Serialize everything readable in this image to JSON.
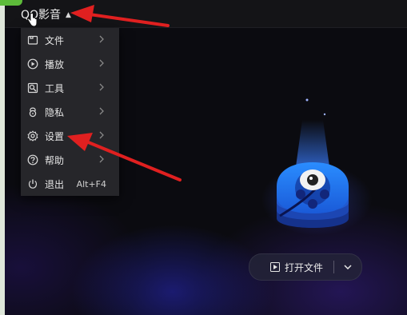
{
  "app": {
    "title": "QQ影音"
  },
  "menu": {
    "items": [
      {
        "label": "文件",
        "icon": "folder-icon",
        "has_submenu": true
      },
      {
        "label": "播放",
        "icon": "play-circle-icon",
        "has_submenu": true
      },
      {
        "label": "工具",
        "icon": "tools-icon",
        "has_submenu": true
      },
      {
        "label": "隐私",
        "icon": "lock-icon",
        "has_submenu": true
      },
      {
        "label": "设置",
        "icon": "gear-icon",
        "has_submenu": true
      },
      {
        "label": "帮助",
        "icon": "help-icon",
        "has_submenu": true
      },
      {
        "label": "退出",
        "icon": "power-icon",
        "shortcut": "Alt+F4"
      }
    ]
  },
  "main": {
    "open_file_label": "打开文件"
  },
  "colors": {
    "annotation_arrow": "#e02020",
    "menu_bg": "#26262a",
    "logo_blue": "#1e7bff"
  }
}
